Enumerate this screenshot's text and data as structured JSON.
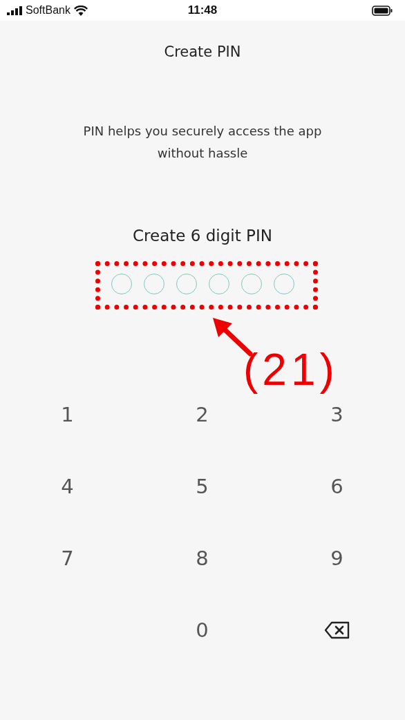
{
  "status_bar": {
    "carrier": "SoftBank",
    "time": "11:48"
  },
  "title": "Create PIN",
  "subtitle": "PIN helps you securely access the app without hassle",
  "pin_heading": "Create 6 digit PIN",
  "pin_slots": [
    {
      "filled": false
    },
    {
      "filled": false
    },
    {
      "filled": false
    },
    {
      "filled": false
    },
    {
      "filled": false
    },
    {
      "filled": false
    }
  ],
  "keypad": [
    {
      "kind": "digit",
      "label": "1"
    },
    {
      "kind": "digit",
      "label": "2"
    },
    {
      "kind": "digit",
      "label": "3"
    },
    {
      "kind": "digit",
      "label": "4"
    },
    {
      "kind": "digit",
      "label": "5"
    },
    {
      "kind": "digit",
      "label": "6"
    },
    {
      "kind": "digit",
      "label": "7"
    },
    {
      "kind": "digit",
      "label": "8"
    },
    {
      "kind": "digit",
      "label": "9"
    },
    {
      "kind": "blank"
    },
    {
      "kind": "digit",
      "label": "0"
    },
    {
      "kind": "backspace"
    }
  ],
  "annotation": {
    "label": "(21)"
  }
}
